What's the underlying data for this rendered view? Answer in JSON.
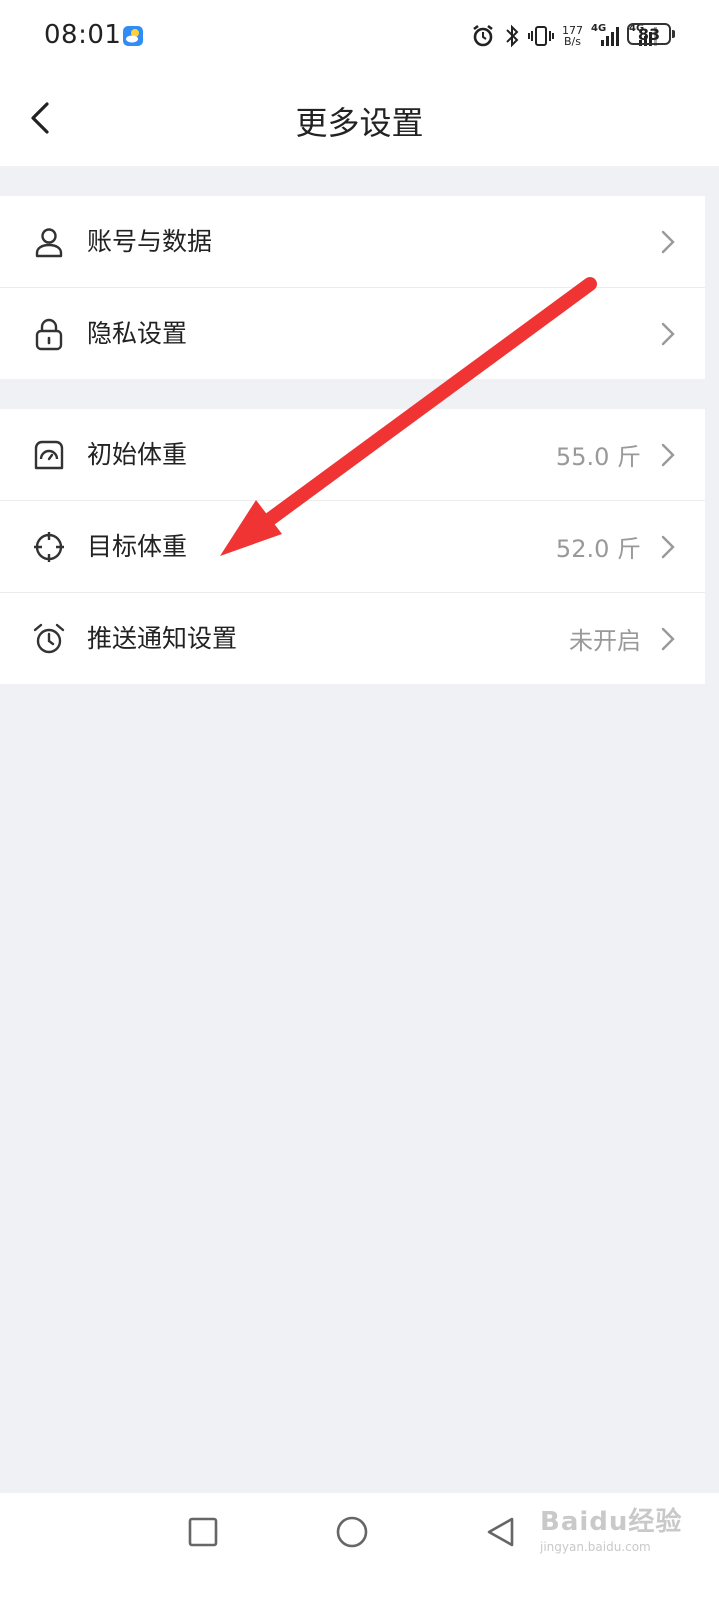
{
  "status_bar": {
    "time": "08:01",
    "net_speed_value": "177",
    "net_speed_unit": "B/s",
    "network_1": "4G",
    "network_2": "4G",
    "battery": "83"
  },
  "header": {
    "title": "更多设置"
  },
  "groups": [
    {
      "items": [
        {
          "label": "账号与数据",
          "value": "",
          "icon": "person-icon"
        },
        {
          "label": "隐私设置",
          "value": "",
          "icon": "lock-icon"
        }
      ]
    },
    {
      "items": [
        {
          "label": "初始体重",
          "value": "55.0 斤",
          "icon": "scale-icon"
        },
        {
          "label": "目标体重",
          "value": "52.0 斤",
          "icon": "target-icon"
        },
        {
          "label": "推送通知设置",
          "value": "未开启",
          "icon": "alarm-clock-icon"
        }
      ]
    }
  ],
  "annotation": {
    "color": "#f03434",
    "points_to": "目标体重"
  },
  "watermark": {
    "line1": "Baidu经验",
    "line2": "jingyan.baidu.com"
  },
  "colors": {
    "background": "#f0f1f5",
    "card": "#ffffff",
    "value_text": "#999999"
  }
}
